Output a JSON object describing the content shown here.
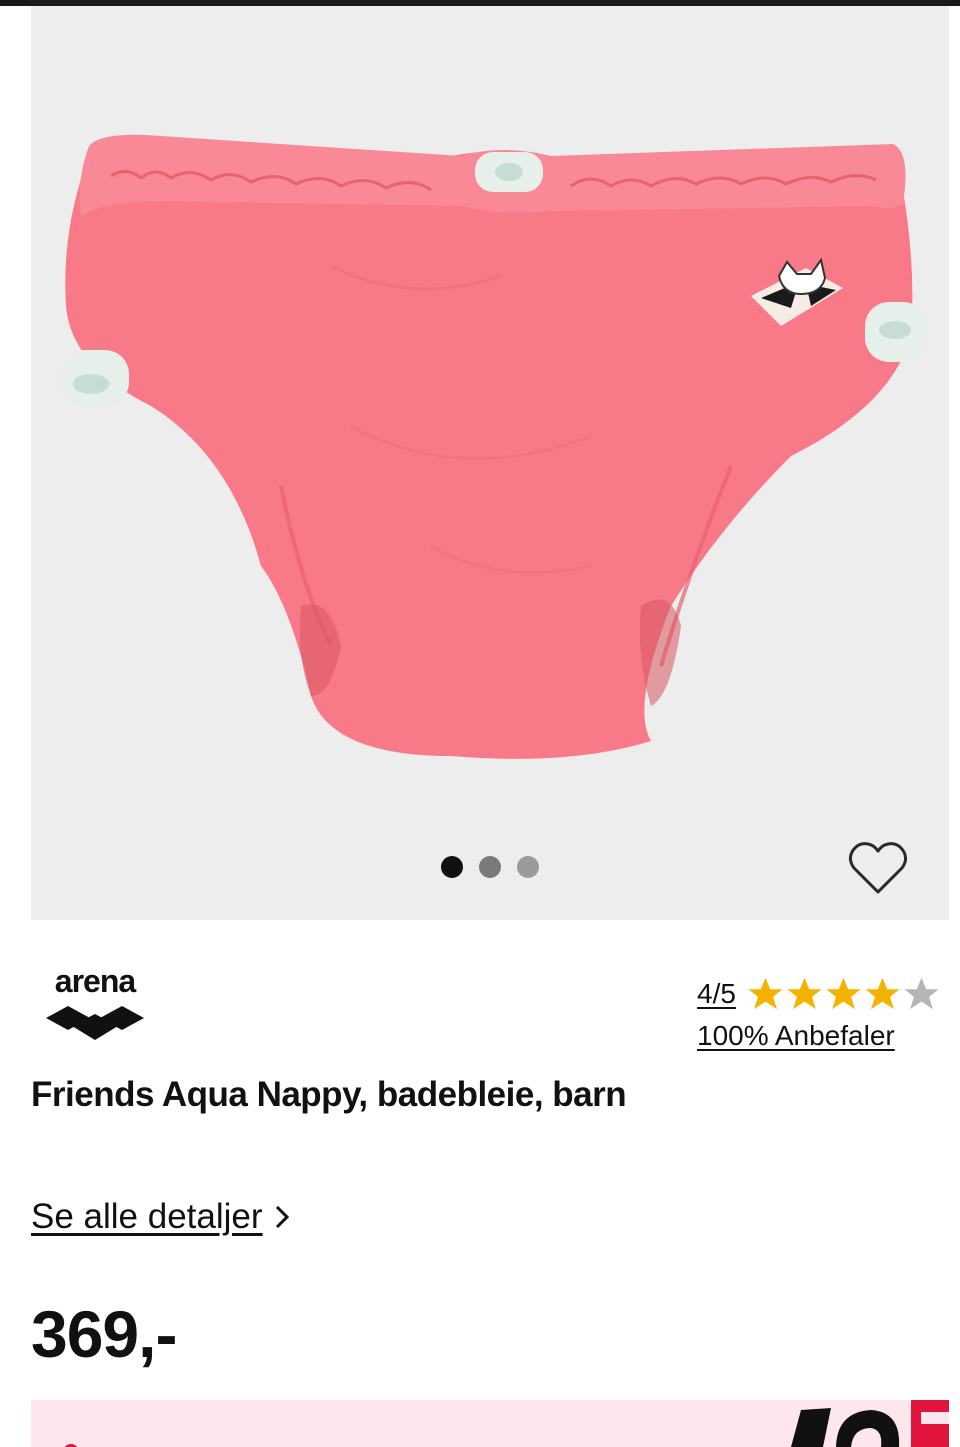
{
  "gallery": {
    "image_alt": "Rosa badebleie",
    "dots_count": 3,
    "active_dot": 0,
    "favorite_icon": "heart-outline-icon"
  },
  "brand": {
    "logo_text": "arena"
  },
  "rating": {
    "score": "4/5",
    "stars_filled": 4,
    "stars_total": 5,
    "star_color": "#f5b301",
    "star_empty_color": "#b5b5b5",
    "recommend": "100% Anbefaler"
  },
  "product": {
    "title": "Friends Aqua Nappy, badebleie, barn",
    "details_link": "Se alle detaljer",
    "price": "369,-"
  },
  "colors": {
    "gallery_bg": "#ededed",
    "product_pink": "#f87a88",
    "banner_bg": "#fde7ec",
    "banner_accent": "#e0143c"
  }
}
